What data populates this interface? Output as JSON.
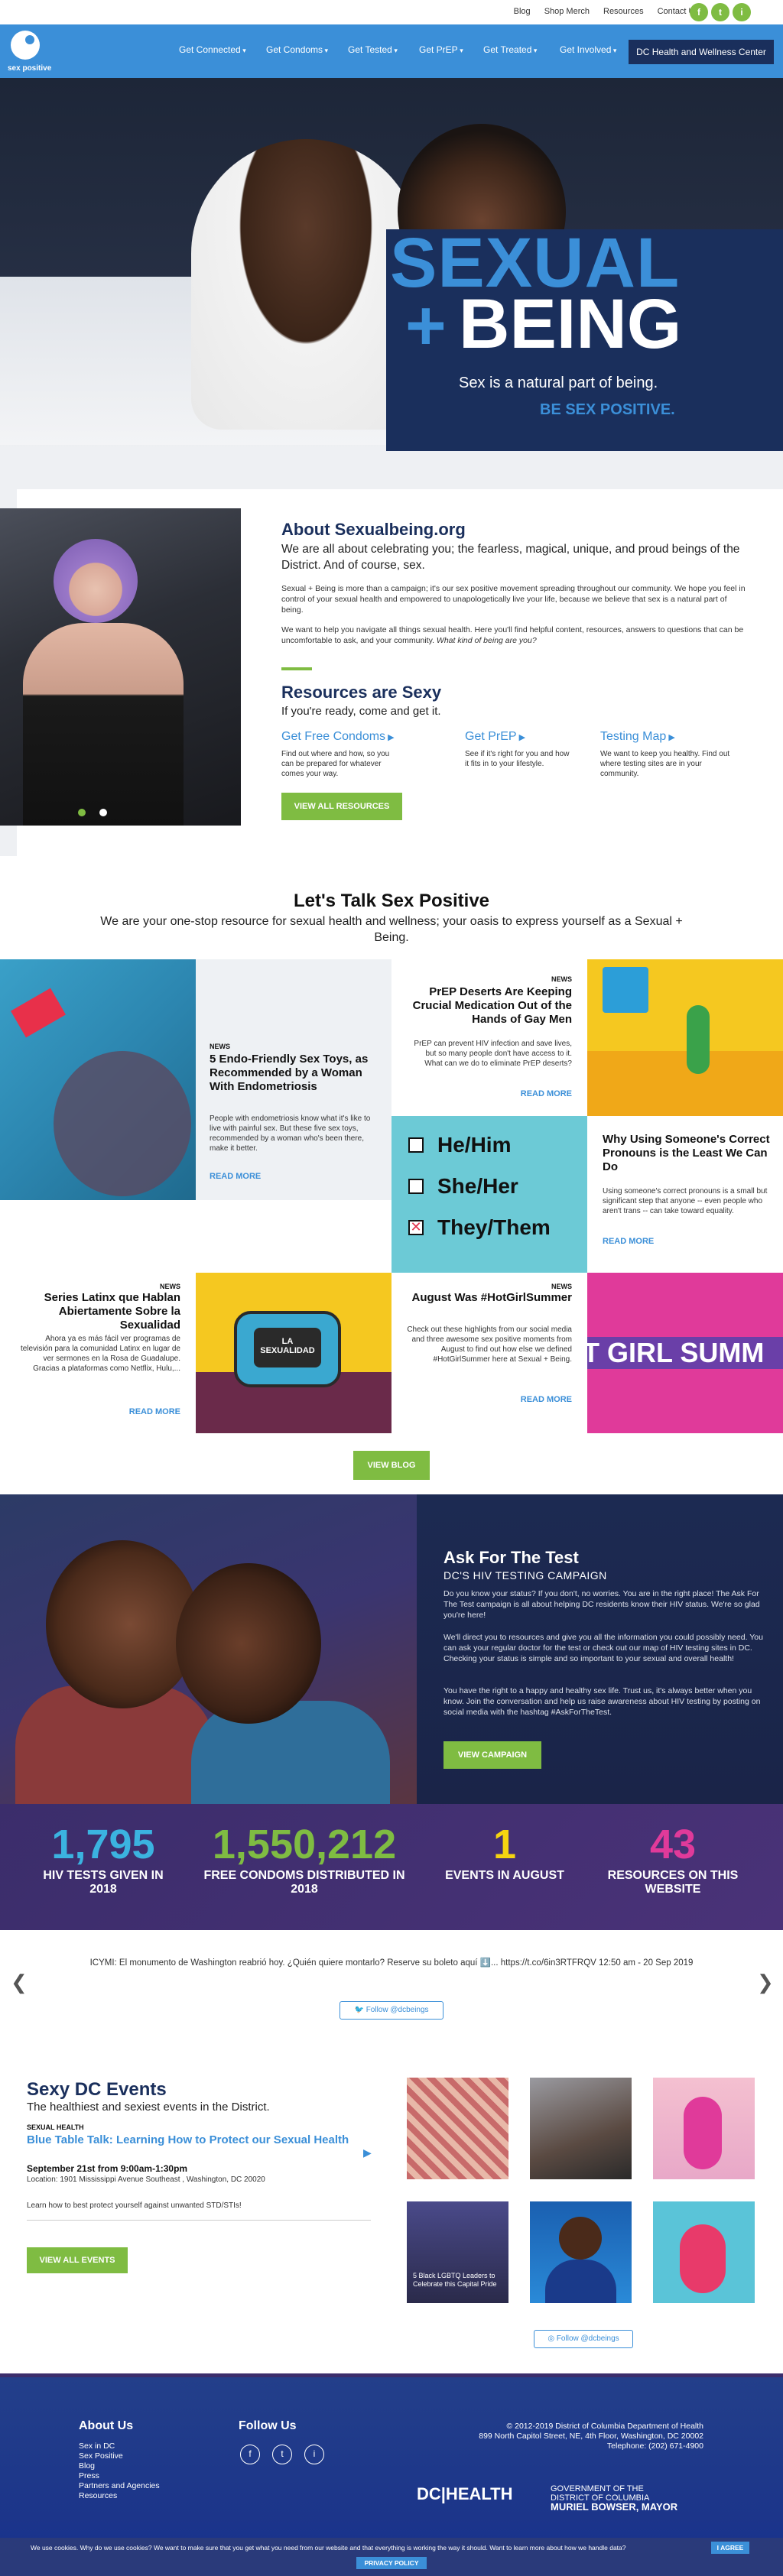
{
  "topbar": {
    "links": [
      "Blog",
      "Shop Merch",
      "Resources",
      "Contact Us"
    ],
    "social": [
      "f",
      "t",
      "i"
    ]
  },
  "nav": {
    "logo_text": "sex positive",
    "items": [
      "Get Connected",
      "Get Condoms",
      "Get Tested",
      "Get PrEP",
      "Get Treated",
      "Get Involved"
    ],
    "cta": "DC Health and Wellness Center"
  },
  "hero": {
    "title_line1": "SEXUAL",
    "plus": "+",
    "title_line2": "BEING",
    "subtitle": "Sex is a natural part of being.",
    "tagline": "BE SEX POSITIVE."
  },
  "about": {
    "heading": "About Sexualbeing.org",
    "lead": "We are all about celebrating you; the fearless, magical, unique, and proud beings of the District. And of course, sex.",
    "para1": "Sexual + Being is more than a campaign; it's our sex positive movement spreading throughout our community. We hope you feel in control of your sexual health and empowered to unapologetically live your life, because we believe that sex is a natural part of being.",
    "para2": "We want to help you navigate all things sexual health. Here you'll find helpful content, resources, answers to questions that can be uncomfortable to ask, and your community.",
    "para2_em": "What kind of being are you?"
  },
  "resources": {
    "heading": "Resources are Sexy",
    "sub": "If you're ready, come and get it.",
    "items": [
      {
        "title": "Get Free Condoms",
        "desc": "Find out where and how, so you can be prepared for whatever comes your way."
      },
      {
        "title": "Get PrEP",
        "desc": "See if it's right for you and how it fits in to your lifestyle."
      },
      {
        "title": "Testing Map",
        "desc": "We want to keep you healthy. Find out where testing sites are in your community."
      }
    ],
    "button": "VIEW ALL RESOURCES"
  },
  "talk": {
    "heading": "Let's Talk Sex Positive",
    "sub": "We are your one-stop resource for sexual health and wellness; your oasis to express yourself as a Sexual + Being."
  },
  "tiles": {
    "news": "NEWS",
    "more": "READ MORE",
    "t1": {
      "title": "5 Endo-Friendly Sex Toys, as Recommended by a Woman With Endometriosis",
      "desc": "People with endometriosis know what it's like to live with painful sex. But these five sex toys, recommended by a woman who's been there, make it better."
    },
    "t2": {
      "title": "PrEP Deserts Are Keeping Crucial Medication Out of the Hands of Gay Men",
      "desc": "PrEP can prevent HIV infection and save lives, but so many people don't have access to it. What can we do to eliminate PrEP deserts?"
    },
    "t3": {
      "title": "Why Using Someone's Correct Pronouns is the Least We Can Do",
      "desc": "Using someone's correct pronouns is a small but significant step that anyone -- even people who aren't trans -- can take toward equality."
    },
    "t4": {
      "title": "Series Latinx que Hablan Abiertamente Sobre la Sexualidad",
      "desc": "Ahora ya es más fácil ver programas de televisión para la comunidad Latinx en lugar de ver sermones en la Rosa de Guadalupe. Gracias a plataformas como Netflix, Hulu,..."
    },
    "t5": {
      "title": "August Was #HotGirlSummer",
      "desc": "Check out these highlights from our social media and three awesome sex positive moments from August to find out how else we defined #HotGirlSummer here at Sexual + Being."
    },
    "pronouns": [
      "He/Him",
      "She/Her",
      "They/Them"
    ],
    "tv_label": "LA SEXUALIDAD",
    "girl_summer": "T GIRL SUMM"
  },
  "blog_button": "VIEW BLOG",
  "ask": {
    "heading": "Ask For The Test",
    "sub": "DC'S HIV TESTING CAMPAIGN",
    "p1": "Do you know your status? If you don't, no worries. You are in the right place! The Ask For The Test campaign is all about helping DC residents know their HIV status. We're so glad you're here!",
    "p2": "We'll direct you to resources and give you all the information you could possibly need. You can ask your regular doctor for the test or check out our map of HIV testing sites in DC. Checking your status is simple and so important to your sexual and overall health!",
    "p3": "You have the right to a happy and healthy sex life. Trust us, it's always better when you know. Join the conversation and help us raise awareness about HIV testing by posting on social media with the hashtag #AskForTheTest.",
    "button": "VIEW CAMPAIGN"
  },
  "stats": [
    {
      "num": "1,795",
      "label": "HIV TESTS GIVEN IN 2018",
      "color": "#3bb3e0"
    },
    {
      "num": "1,550,212",
      "label": "FREE CONDOMS DISTRIBUTED IN 2018",
      "color": "#7fbc42"
    },
    {
      "num": "1",
      "label": "EVENTS IN AUGUST",
      "color": "#f5d410"
    },
    {
      "num": "43",
      "label": "RESOURCES ON THIS WEBSITE",
      "color": "#e03a9a"
    }
  ],
  "twitter": {
    "tweet": "ICYMI: El monumento de Washington reabrió hoy. ¿Quién quiere montarlo? Reserve su boleto aquí ⬇️... https://t.co/6in3RTFRQV 12:50 am - 20 Sep 2019",
    "follow": "Follow @dcbeings"
  },
  "events": {
    "heading": "Sexy DC Events",
    "sub": "The healthiest and sexiest events in the District.",
    "category": "SEXUAL HEALTH",
    "title": "Blue Table Talk: Learning How to Protect our Sexual Health",
    "date": "September 21st from 9:00am-1:30pm",
    "location": "Location: 1901 Mississippi Avenue Southeast , Washington, DC 20020",
    "desc": "Learn how to best protect yourself against unwanted STD/STIs!",
    "button": "VIEW ALL EVENTS",
    "insta_text": "5 Black LGBTQ Leaders to Celebrate this Capital Pride",
    "follow": "Follow @dcbeings"
  },
  "footer": {
    "about_h": "About Us",
    "about_links": [
      "Sex in DC",
      "Sex Positive",
      "Blog",
      "Press",
      "Partners and Agencies",
      "Resources"
    ],
    "follow_h": "Follow Us",
    "social": [
      "f",
      "t",
      "i"
    ],
    "copyright": "© 2012-2019 District of Columbia Department of Health",
    "address": "899 North Capitol Street, NE, 4th Floor, Washington, DC 20002",
    "phone": "Telephone: (202) 671-4900",
    "dc_logo": "DC|HEALTH",
    "gov1": "GOVERNMENT OF THE",
    "gov2": "DISTRICT OF COLUMBIA",
    "gov3": "MURIEL BOWSER, MAYOR"
  },
  "cookie": {
    "text": "We use cookies. Why do we use cookies? We want to make sure that you get what you need from our website and that everything is working the way it should. Want to learn more about how we handle data?",
    "agree": "I AGREE",
    "privacy": "PRIVACY POLICY"
  }
}
